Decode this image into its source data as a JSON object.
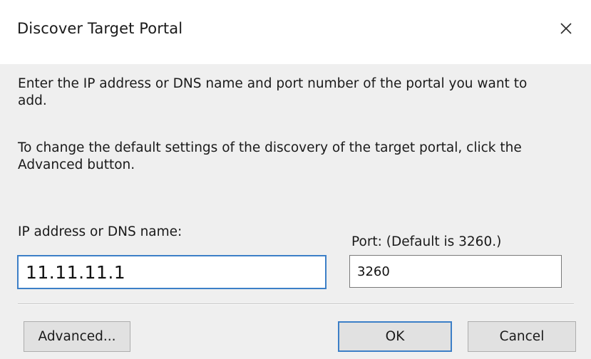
{
  "window": {
    "title": "Discover Target Portal",
    "close_icon": "close-icon"
  },
  "instructions": {
    "line1": "Enter the IP address or DNS name and port number of the portal you want to add.",
    "line2": "To change the default settings of the discovery of the target portal, click the Advanced button."
  },
  "fields": {
    "ip_label": "IP address or DNS name:",
    "ip_value": "11.11.11.1",
    "port_label": "Port: (Default is 3260.)",
    "port_value": "3260"
  },
  "buttons": {
    "advanced": "Advanced...",
    "ok": "OK",
    "cancel": "Cancel"
  },
  "colors": {
    "focus_border": "#3c7fc7",
    "body_background": "#efefef",
    "titlebar_background": "#ffffff"
  }
}
